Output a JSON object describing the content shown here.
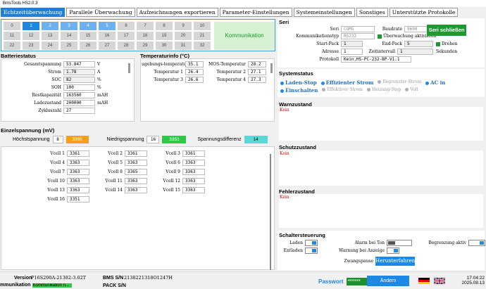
{
  "window": {
    "title": "BmsTools HS2.0.3"
  },
  "tabs": [
    "Echtzeitüberwachung",
    "Parallele Überwachung",
    "Aufzeichnungen exportieren",
    "Parameter-Einstellungen",
    "Systemeinstellungen",
    "Sonstiges",
    "Unterstützte Protokolle"
  ],
  "grid": {
    "cells": [
      "0",
      "1",
      "2",
      "3",
      "4",
      "5",
      "6",
      "7",
      "8",
      "9",
      "10",
      "11",
      "12",
      "13",
      "14",
      "15",
      "16",
      "17",
      "18",
      "19",
      "20",
      "21",
      "22",
      "23",
      "24",
      "25",
      "26",
      "27",
      "28",
      "29",
      "30",
      "31",
      "32"
    ],
    "status": "Kommunikation"
  },
  "battery": {
    "title": "Batteriestatus",
    "rows": [
      {
        "label": "Gesamtspannung",
        "value": "53.847",
        "unit": "V"
      },
      {
        "label": "Strom",
        "value": "1.78",
        "unit": "A"
      },
      {
        "label": "SOC",
        "value": "82",
        "unit": "%"
      },
      {
        "label": "SOH",
        "value": "100",
        "unit": "%"
      },
      {
        "label": "Restkapazität",
        "value": "163560",
        "unit": "mAH"
      },
      {
        "label": "Ladezustand",
        "value": "200000",
        "unit": "mAH"
      },
      {
        "label": "Zykluszahl",
        "value": "27",
        "unit": ""
      }
    ]
  },
  "temperature": {
    "title": "Temperaturinfo (°C)",
    "rows": [
      {
        "l1": "ugebungs-temperatur",
        "v1": "35.1",
        "l2": "MOS-Temperatur",
        "v2": "28.2"
      },
      {
        "l1": "Temperatur 1",
        "v1": "26.4",
        "l2": "Temperatur 2",
        "v2": "27.1"
      },
      {
        "l1": "Temperatur 3",
        "v1": "26.6",
        "l2": "Temperatur 4",
        "v2": "27.3"
      }
    ]
  },
  "cells": {
    "title": "Einzelspannung (mV)",
    "max_label": "Höchstspannung",
    "max_idx": "8",
    "max_val": "3365",
    "min_label": "Niedrigspannung",
    "min_idx": "16",
    "min_val": "3351",
    "diff_label": "Spannungsdifferenz",
    "diff_val": "14",
    "list": [
      {
        "label": "Vcell 1",
        "value": "3361"
      },
      {
        "label": "Vcell 2",
        "value": "3361"
      },
      {
        "label": "Vcell 3",
        "value": "3361"
      },
      {
        "label": "Vcell 4",
        "value": "3363"
      },
      {
        "label": "Vcell 5",
        "value": "3363"
      },
      {
        "label": "Vcell 6",
        "value": "3363"
      },
      {
        "label": "Vcell 7",
        "value": "3363"
      },
      {
        "label": "Vcell 8",
        "value": "3365"
      },
      {
        "label": "Vcell 9",
        "value": "3363"
      },
      {
        "label": "Vcell 10",
        "value": "3363"
      },
      {
        "label": "Vcell 11",
        "value": "3363"
      },
      {
        "label": "Vcell 12",
        "value": "3363"
      },
      {
        "label": "Vcell 13",
        "value": "3363"
      },
      {
        "label": "Vcell 14",
        "value": "3363"
      },
      {
        "label": "Vcell 15",
        "value": "3363"
      },
      {
        "label": "Vcell 16",
        "value": "3351"
      }
    ]
  },
  "serial": {
    "title": "Seri",
    "seri_label": "Seri",
    "seri_val": "COM5",
    "baud_label": "Baudrate",
    "baud_val": "9600",
    "comm_label": "Kommunikationstyp",
    "comm_val": "RS232",
    "monitor_label": "Überwachung aktivieren",
    "start_label": "Start-Pack",
    "start_val": "1",
    "end_label": "End-Pack",
    "end_val": "5",
    "rotate_label": "Drehen",
    "addr_label": "Adresse",
    "addr_val": "1",
    "interval_label": "Zeitintervall",
    "interval_val": "1",
    "interval_unit": "Sekunden",
    "proto_label": "Protokoll",
    "proto_val": "Kein,HS-PC-232-BP-V1.1",
    "close_btn": "Seri schließen"
  },
  "system": {
    "title": "Systemstatus",
    "row1": [
      {
        "t": "Laden-Stop",
        "on": true
      },
      {
        "t": "Effizienter Strom",
        "on": true
      },
      {
        "t": "Begrenzter Strom",
        "on": false
      },
      {
        "t": "AC in",
        "on": true
      }
    ],
    "row2": [
      {
        "t": "Einschalten",
        "on": true
      },
      {
        "t": "Effektiver Strom",
        "on": false
      },
      {
        "t": "Heizung-Stop",
        "on": false
      },
      {
        "t": "Voll",
        "on": false
      }
    ]
  },
  "warn": {
    "title": "Warnzustand",
    "text": "Kein"
  },
  "protect": {
    "title": "Schutzzustand",
    "text": "Kein"
  },
  "fault": {
    "title": "Fehlerzustand",
    "text": "Kein"
  },
  "switch": {
    "title": "Schaltersteuerung",
    "charge": "Laden",
    "discharge": "Entladen",
    "alarm": "Alarm bei Ton",
    "warn_display": "Warnung bei Anzeige",
    "limit": "Begrenzung aktiv",
    "force": "Zwangspause",
    "shutdown": "Herunterfahren"
  },
  "footer": {
    "version_label": "Version",
    "version_val": "P16S200A-21382-3.02T",
    "bms_label": "BMS S/N",
    "bms_val": "2138221318O1247H",
    "comm_label": "mmunikation",
    "comm_val": "Kommunikation n...",
    "pack_label": "PACK S/N",
    "pwd_label": "Passwort",
    "pwd_val": "******",
    "change_btn": "Ändern",
    "time": "17:04:22",
    "date": "2025.08.13"
  }
}
